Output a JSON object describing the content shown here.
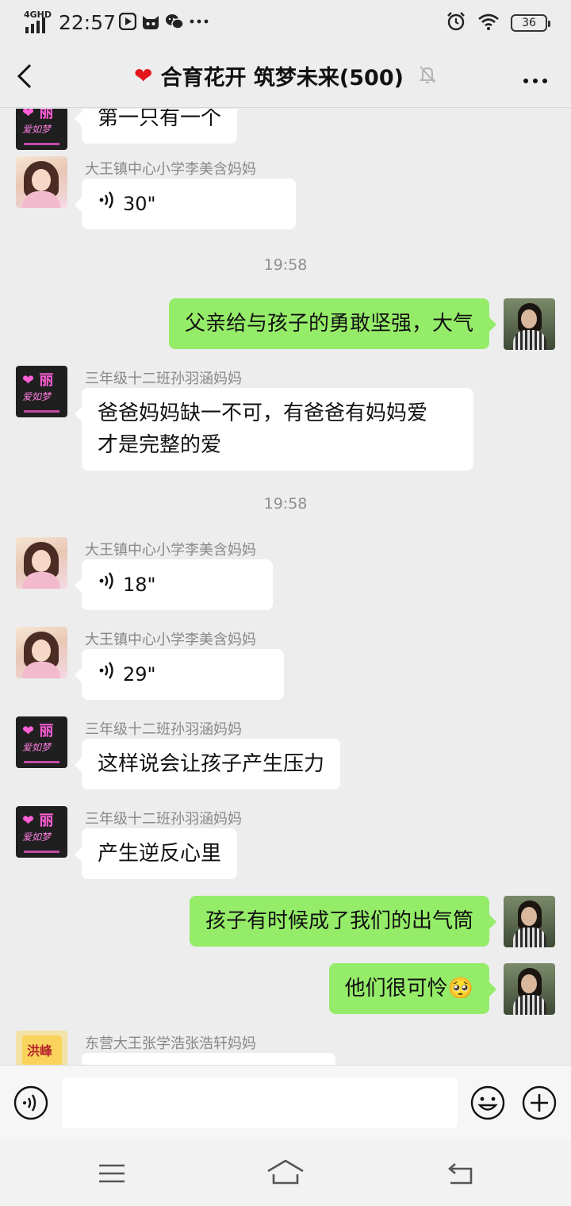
{
  "status_bar": {
    "network": "4GHD",
    "time": "22:57",
    "battery": "36",
    "icons": [
      "video-app-icon",
      "cat-app-icon",
      "wechat-icon",
      "more-dots"
    ]
  },
  "header": {
    "title": "合育花开 筑梦未来(500)",
    "title_icon": "red-heart",
    "muted_icon": "bell-off-icon"
  },
  "messages": [
    {
      "side": "left",
      "avatar": "neon",
      "sender": "",
      "text": "第一只有一个"
    },
    {
      "side": "left",
      "avatar": "girl",
      "sender": "大王镇中心小学李美含妈妈",
      "voice_duration": "30\""
    },
    {
      "time": "19:58"
    },
    {
      "side": "right",
      "avatar": "woman",
      "text": "父亲给与孩子的勇敢坚强，大气"
    },
    {
      "side": "left",
      "avatar": "neon",
      "sender": "三年级十二班孙羽涵妈妈",
      "text_lines": [
        "爸爸妈妈缺一不可，有爸爸有妈妈爱",
        "才是完整的爱"
      ]
    },
    {
      "time": "19:58"
    },
    {
      "side": "left",
      "avatar": "girl",
      "sender": "大王镇中心小学李美含妈妈",
      "voice_duration": "18\""
    },
    {
      "side": "left",
      "avatar": "girl",
      "sender": "大王镇中心小学李美含妈妈",
      "voice_duration": "29\""
    },
    {
      "side": "left",
      "avatar": "neon",
      "sender": "三年级十二班孙羽涵妈妈",
      "text": "这样说会让孩子产生压力"
    },
    {
      "side": "left",
      "avatar": "neon",
      "sender": "三年级十二班孙羽涵妈妈",
      "text": "产生逆反心里"
    },
    {
      "side": "right",
      "avatar": "woman",
      "text": "孩子有时候成了我们的出气筒"
    },
    {
      "side": "right",
      "avatar": "woman",
      "text": "他们很可怜",
      "emoji": "🥺"
    },
    {
      "side": "left",
      "avatar": "rice",
      "sender": "东营大王张学浩张浩轩妈妈",
      "text": ""
    }
  ],
  "avatar_text": {
    "neon_title": "❤ 丽",
    "neon_script": "爱如梦",
    "rice_brand": "洪峰"
  },
  "input_bar": {
    "value": "",
    "voice_icon": "voice-input-icon",
    "emoji_icon": "emoji-icon",
    "plus_icon": "plus-icon"
  },
  "nav_bar": {
    "icons": [
      "menu-icon",
      "home-icon",
      "back-icon"
    ]
  },
  "colors": {
    "background": "#ededed",
    "bubble_self": "#95ec69",
    "bubble_other": "#ffffff",
    "sender_name": "#888888"
  }
}
